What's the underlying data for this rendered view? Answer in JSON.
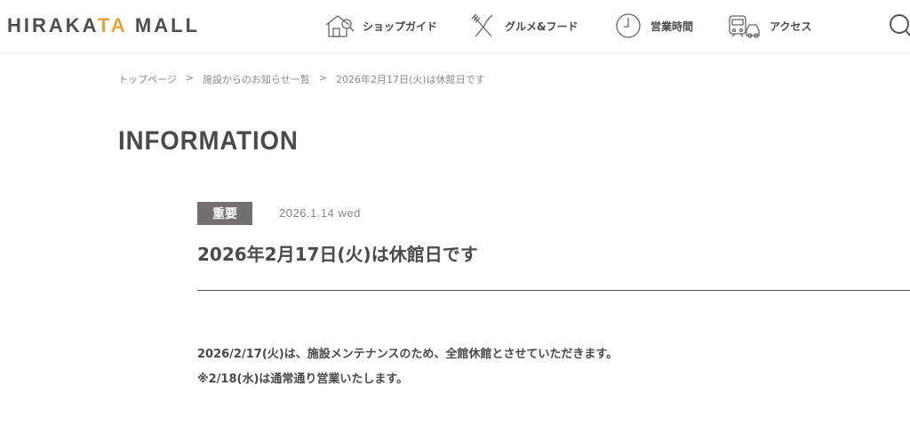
{
  "header": {
    "logo_left": "HIRAKA",
    "logo_accent": "TA",
    "logo_right": " MALL",
    "nav": [
      {
        "label": "ショップガイド",
        "icon": "shop-icon"
      },
      {
        "label": "グルメ&フード",
        "icon": "fork-knife-icon"
      },
      {
        "label": "営業時間",
        "icon": "clock-icon"
      },
      {
        "label": "アクセス",
        "icon": "train-car-icon"
      }
    ],
    "search_icon": "search-icon"
  },
  "breadcrumb": {
    "items": [
      "トップページ",
      "施設からのお知らせ一覧",
      "2026年2月17日(火)は休館日です"
    ],
    "separator": ">"
  },
  "page": {
    "title": "INFORMATION",
    "badge": "重要",
    "date": "2026.1.14 wed",
    "article_title": "2026年2月17日(火)は休館日です",
    "body": [
      "2026/2/17(火)は、施設メンテナンスのため、全館休館とさせていただきます。",
      "※2/18(水)は通常通り営業いたします。"
    ]
  },
  "colors": {
    "accent": "#e6a23c",
    "badge_bg": "#757070",
    "text": "#4a4a4a"
  }
}
